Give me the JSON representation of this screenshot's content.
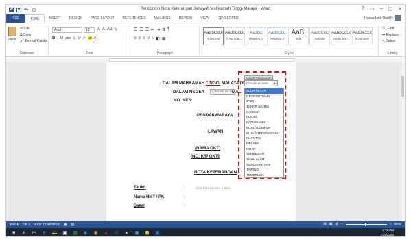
{
  "window": {
    "title": "Pencontoh Nota Keterangan Jenayah Mahkamah Tinggi Malaya - Word",
    "controls": [
      "?",
      "▭",
      "–",
      "▢",
      "✕"
    ]
  },
  "tabs": [
    "FILE",
    "HOME",
    "INSERT",
    "DESIGN",
    "PAGE LAYOUT",
    "REFERENCES",
    "MAILINGS",
    "REVIEW",
    "VIEW",
    "DEVELOPER"
  ],
  "active_tab": "HOME",
  "user": {
    "name": "Huzaa binti Osdiffy"
  },
  "ribbon": {
    "clipboard": {
      "paste": "Paste",
      "cut": "Cut",
      "copy": "Copy",
      "format_painter": "Format Painter",
      "label": "Clipboard"
    },
    "font": {
      "family": "Arial",
      "size": "12",
      "label": "Font",
      "buttons": [
        "B",
        "I",
        "U",
        "abc",
        "x₂",
        "x²",
        "A",
        "ab",
        "A"
      ]
    },
    "paragraph": {
      "label": "Paragraph"
    },
    "styles": {
      "label": "Styles",
      "items": [
        {
          "preview": "AaBbCcDc",
          "name": "¶ Normal"
        },
        {
          "preview": "AaBbCcDc",
          "name": "¶ No Spac..."
        },
        {
          "preview": "AaBbC",
          "name": "Heading 1"
        },
        {
          "preview": "AaBbCcE",
          "name": "Heading 2"
        },
        {
          "preview": "AaBl",
          "name": "Title"
        },
        {
          "preview": "AaBbCcC",
          "name": "Subtitle"
        },
        {
          "preview": "AaBbCcDc",
          "name": "Subtle Em..."
        },
        {
          "preview": "AaBbCcDc",
          "name": "Emphasis"
        }
      ]
    },
    "editing": {
      "label": "Editing",
      "find": "Find",
      "replace": "Replace",
      "select": "Select"
    }
  },
  "document": {
    "heading1_a": "DALAM MAHKAMAH ",
    "heading1_b": "TINGGI",
    "heading1_c": " MALAYA DI",
    "heading2_a": "DALAM NEGER",
    "heading2_b": "MAL",
    "heading3": "NO. KES:",
    "pendakwaraya": "PENDAKWARAYA",
    "lawan": "LAWAN",
    "nama_okt": "(NAMA OKT)",
    "no_kp_okt": "(NO. K/P OKT)",
    "nota_keterangan": "NOTA KETERANGAN",
    "inline_choose": "Choose an ite",
    "fields": [
      {
        "label": "Tarikh",
        "hint": "Click here to enter a date."
      },
      {
        "label": "Nama HMT / PK",
        "hint": ""
      },
      {
        "label": "Saksi",
        "hint": ""
      }
    ],
    "colon": ":"
  },
  "content_control": {
    "title": "Lokasi Mahkamah",
    "placeholder": "Choose an item.",
    "selected": "ALOR SETAR",
    "items": [
      "ALOR SETAR",
      "GEORGETOWN",
      "IPOH",
      "JOHOR BAHRU",
      "KANGAR",
      "KLANG",
      "KOTA BHARU",
      "KUALA LUMPUR",
      "KUALA TERENGGANU",
      "KUANTAN",
      "MELAKA",
      "MUAR",
      "SEREMBAN",
      "SHAH ALAM",
      "SUNGAI PETANI",
      "TAIPING",
      "TEMERLOH"
    ]
  },
  "status": {
    "page": "PAGE 1 OF 2",
    "words": "2 OF 73 WORDS",
    "zoom": "80%"
  },
  "taskbar": {
    "time": "4:31 PM",
    "date": "7/14/2020"
  }
}
